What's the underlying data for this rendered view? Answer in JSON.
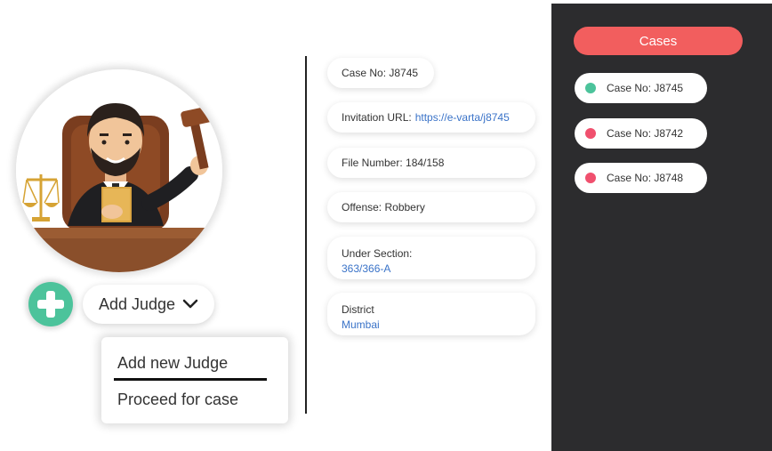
{
  "judge": {
    "dropdown_label": "Add Judge",
    "menu": [
      "Add new Judge",
      "Proceed for case"
    ]
  },
  "details": {
    "case_no": "Case No: J8745",
    "invitation_label": "Invitation URL:",
    "invitation_url": "https://e-varta/j8745",
    "file_number": "File Number: 184/158",
    "offense": "Offense: Robbery",
    "section_label": "Under Section:",
    "section_value": "363/366-A",
    "district_label": "District",
    "district_value": "Mumbai"
  },
  "cases_panel": {
    "title": "Cases",
    "items": [
      {
        "label": "Case No: J8745",
        "status_color": "#4cc39b"
      },
      {
        "label": "Case No: J8742",
        "status_color": "#f0506e"
      },
      {
        "label": "Case No: J8748",
        "status_color": "#f0506e"
      }
    ]
  },
  "colors": {
    "accent_green": "#4cc39b",
    "accent_red": "#f25e5e",
    "link_blue": "#3a73c8",
    "panel_dark": "#2c2c2e"
  }
}
